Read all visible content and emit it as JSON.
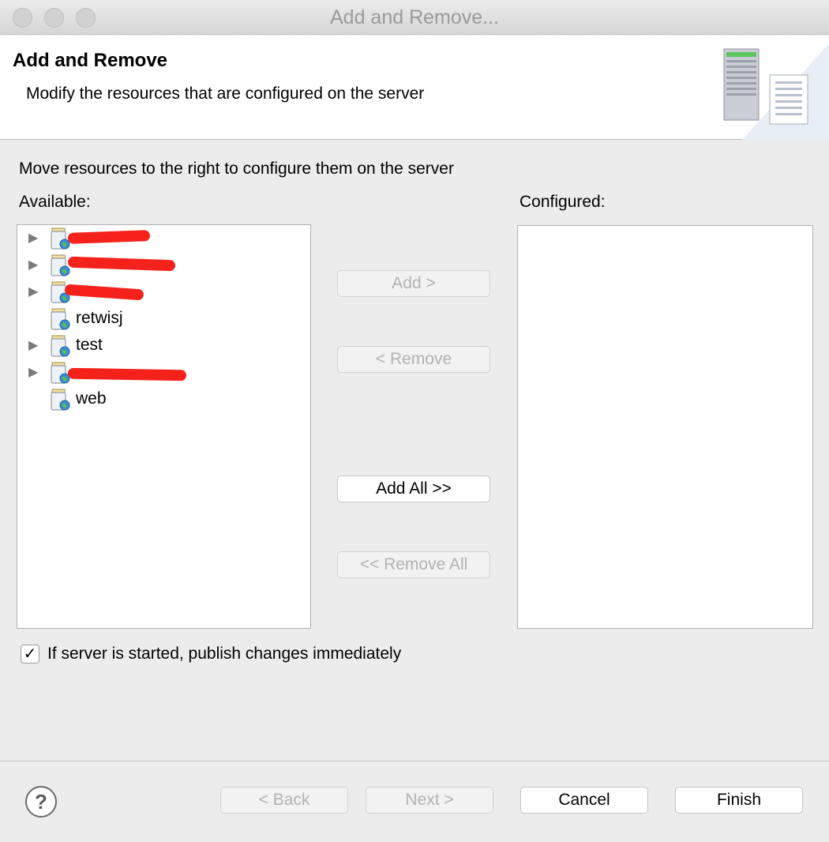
{
  "window": {
    "title": "Add and Remove..."
  },
  "banner": {
    "title": "Add and Remove",
    "description": "Modify the resources that are configured on the server",
    "icon": "server-icon"
  },
  "instruction": "Move resources to the right to configure them on the server",
  "available": {
    "label": "Available:",
    "items": [
      {
        "label": "",
        "expandable": true,
        "redacted": true
      },
      {
        "label": "",
        "expandable": true,
        "redacted": true
      },
      {
        "label": "",
        "expandable": true,
        "redacted": true
      },
      {
        "label": "retwisj",
        "expandable": false
      },
      {
        "label": "test",
        "expandable": true
      },
      {
        "label": "",
        "expandable": true,
        "redacted": true
      },
      {
        "label": "web",
        "expandable": false
      }
    ]
  },
  "configured": {
    "label": "Configured:"
  },
  "buttons": {
    "add": "Add >",
    "remove": "< Remove",
    "add_all": "Add All >>",
    "remove_all": "<< Remove All"
  },
  "publish_checkbox": {
    "label": "If server is started, publish changes immediately",
    "checked": true,
    "mark": "✓"
  },
  "footer": {
    "help": "?",
    "back": "< Back",
    "next": "Next >",
    "cancel": "Cancel",
    "finish": "Finish"
  },
  "colors": {
    "redaction": "#f5221b",
    "window_bg": "#ececec"
  }
}
